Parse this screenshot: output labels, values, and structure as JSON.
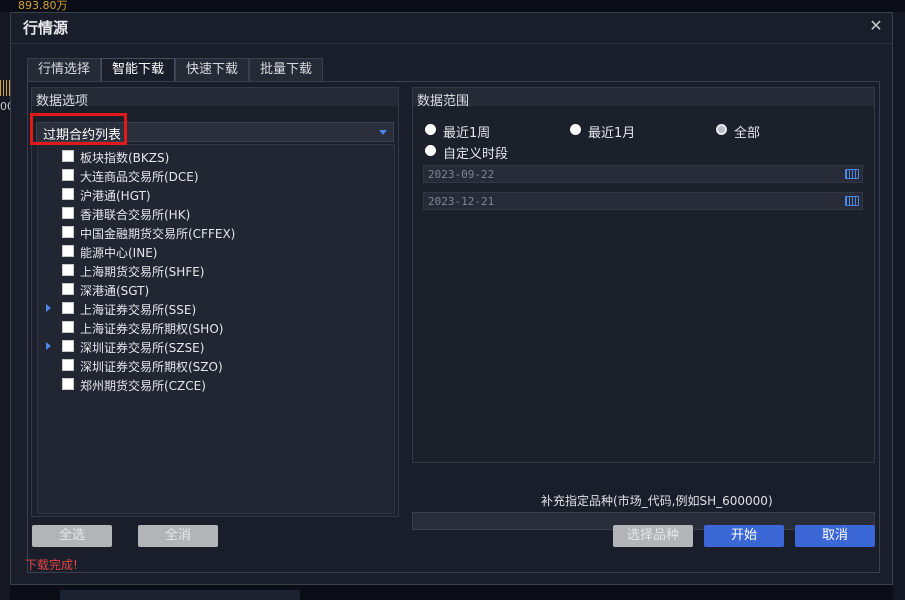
{
  "background": {
    "price_text": "893.80万",
    "left_label": "00"
  },
  "dialog": {
    "title": "行情源",
    "close_glyph": "✕"
  },
  "tabs": [
    {
      "label": "行情选择",
      "active": false
    },
    {
      "label": "智能下载",
      "active": true
    },
    {
      "label": "快速下载",
      "active": false
    },
    {
      "label": "批量下载",
      "active": false
    }
  ],
  "left_group": {
    "title": "数据选项",
    "dropdown_value": "过期合约列表",
    "items": [
      {
        "label": "板块指数(BKZS)",
        "expandable": false,
        "checked": false
      },
      {
        "label": "大连商品交易所(DCE)",
        "expandable": false,
        "checked": false
      },
      {
        "label": "沪港通(HGT)",
        "expandable": false,
        "checked": false
      },
      {
        "label": "香港联合交易所(HK)",
        "expandable": false,
        "checked": false
      },
      {
        "label": "中国金融期货交易所(CFFEX)",
        "expandable": false,
        "checked": false
      },
      {
        "label": "能源中心(INE)",
        "expandable": false,
        "checked": false
      },
      {
        "label": "上海期货交易所(SHFE)",
        "expandable": false,
        "checked": false
      },
      {
        "label": "深港通(SGT)",
        "expandable": false,
        "checked": false
      },
      {
        "label": "上海证券交易所(SSE)",
        "expandable": true,
        "checked": false
      },
      {
        "label": "上海证券交易所期权(SHO)",
        "expandable": false,
        "checked": false
      },
      {
        "label": "深圳证券交易所(SZSE)",
        "expandable": true,
        "checked": false
      },
      {
        "label": "深圳证券交易所期权(SZO)",
        "expandable": false,
        "checked": false
      },
      {
        "label": "郑州期货交易所(CZCE)",
        "expandable": false,
        "checked": false
      }
    ]
  },
  "right_group": {
    "title": "数据范围",
    "radios": {
      "last_week": "最近1周",
      "last_month": "最近1月",
      "all": "全部",
      "custom": "自定义时段"
    },
    "selected_radio": "all",
    "start_date": "2023-09-22",
    "end_date": "2023-12-21"
  },
  "extra": {
    "hint": "补充指定品种(市场_代码,例如SH_600000)",
    "value": ""
  },
  "buttons": {
    "select_all": "全选",
    "deselect_all": "全消",
    "select_variety": "选择品种",
    "start": "开始",
    "cancel": "取消"
  },
  "status": "下载完成!"
}
